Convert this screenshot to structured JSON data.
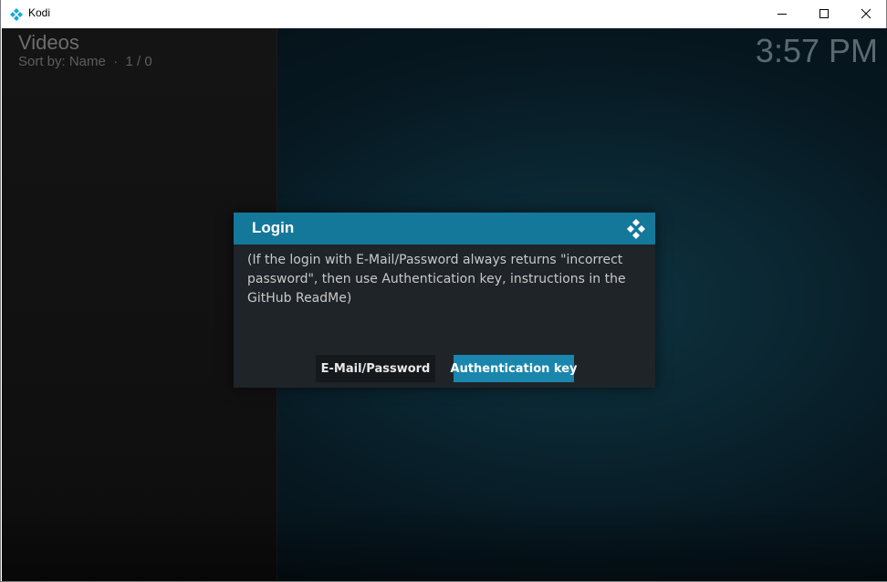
{
  "window": {
    "title": "Kodi",
    "icons": {
      "app": "kodi-logo-icon",
      "minimize": "minimize-icon",
      "maximize": "maximize-icon",
      "close": "close-icon"
    }
  },
  "header": {
    "title": "Videos",
    "sort_info": "Sort by: Name  ·  1 / 0",
    "clock": "3:57 PM"
  },
  "dialog": {
    "title": "Login",
    "message": "(If the login with E-Mail/Password always returns \"incorrect password\", then use Authentication key, instructions in the GitHub ReadMe)",
    "buttons": {
      "email_label": "E-Mail/Password",
      "auth_label": "Authentication key"
    },
    "logo_icon": "kodi-logo-icon"
  },
  "colors": {
    "accent": "#14789a",
    "button_focus": "#1a86ad",
    "dialog_bg": "#1e2428"
  }
}
